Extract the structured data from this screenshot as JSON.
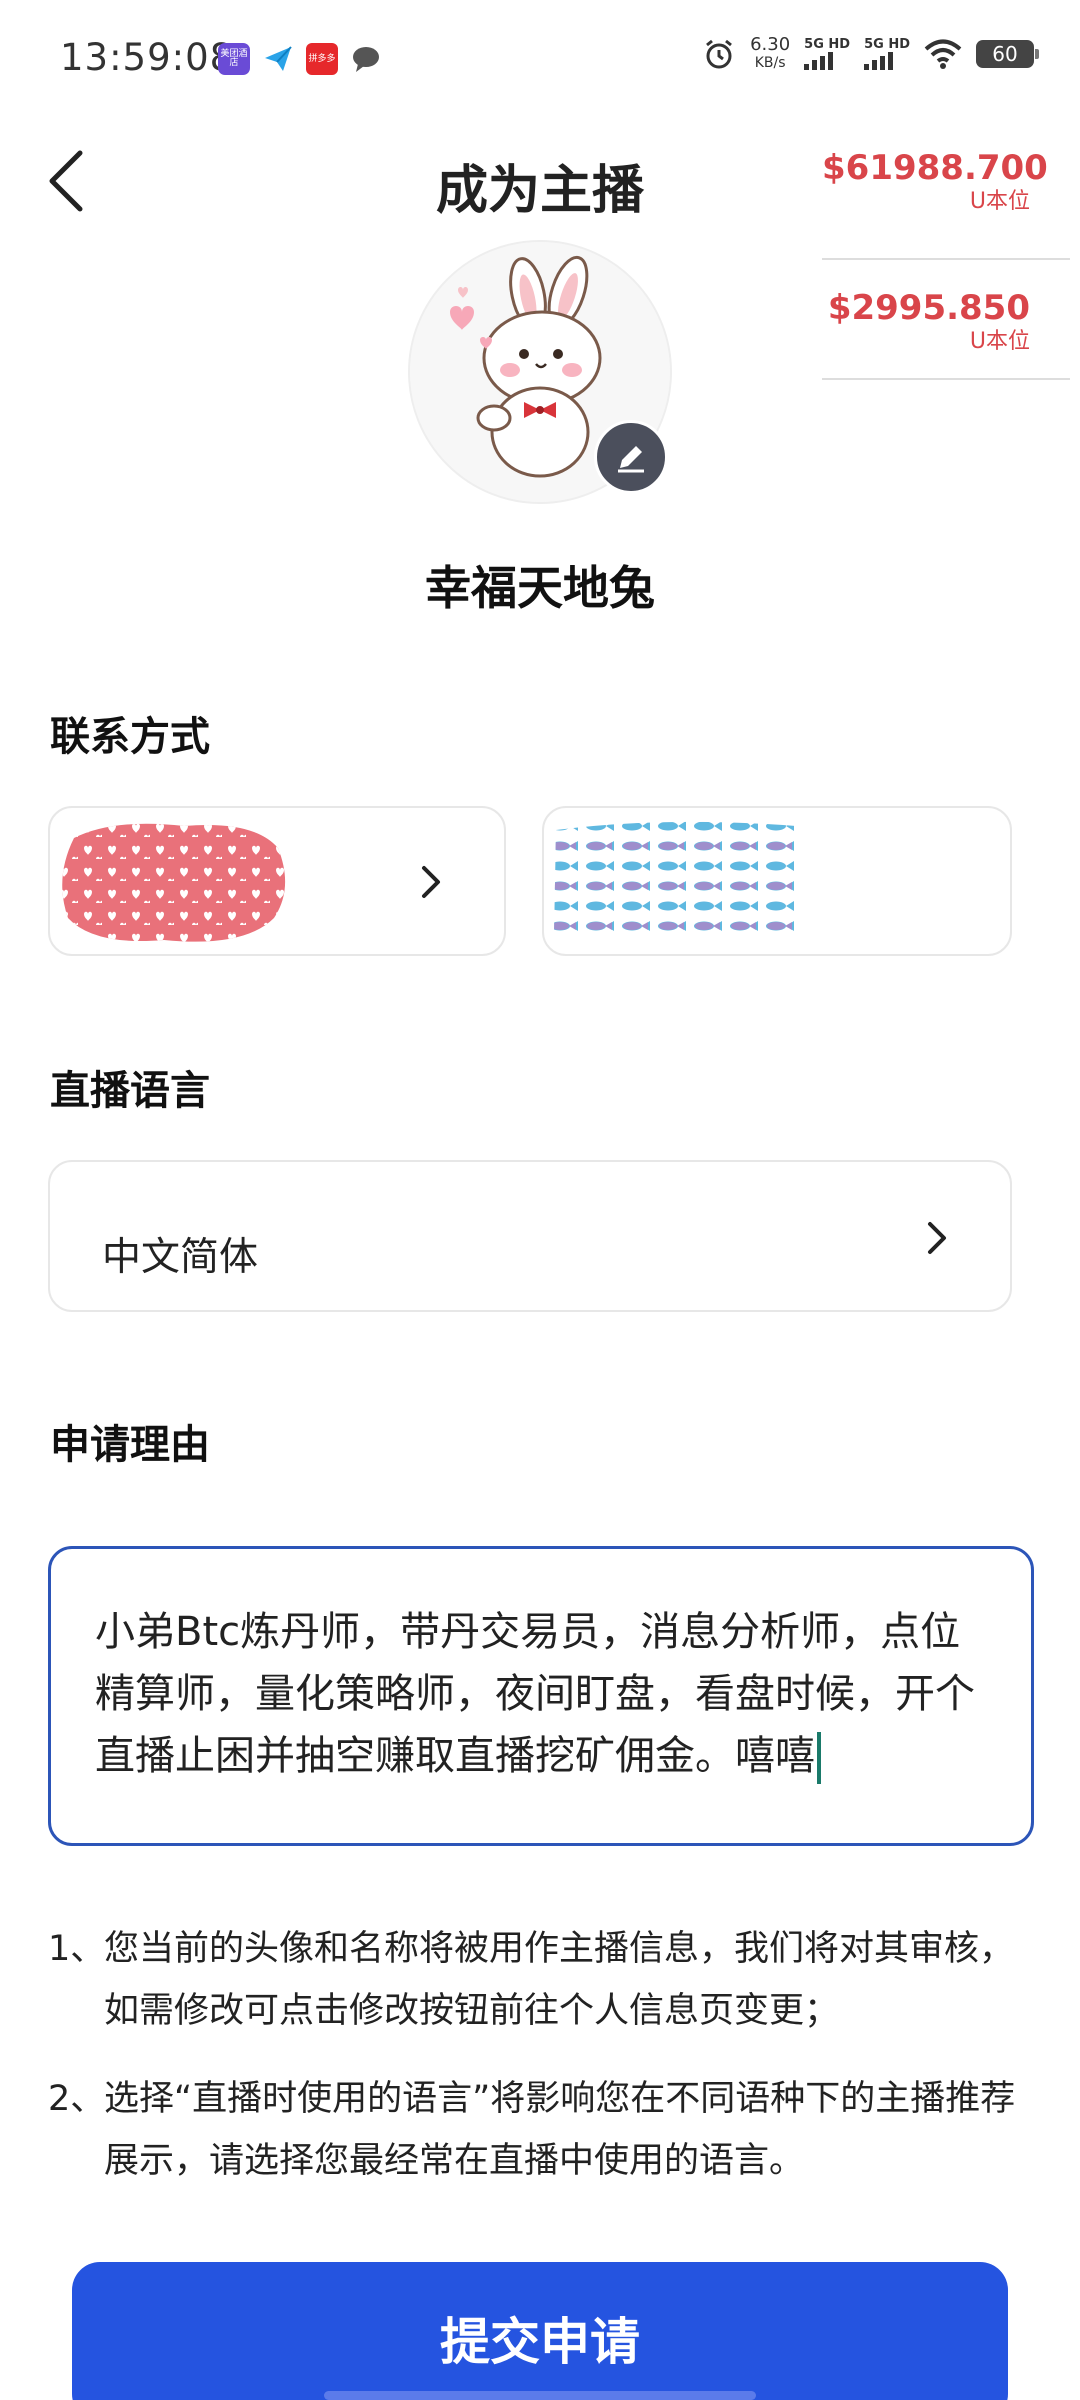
{
  "status_bar": {
    "time": "13:59:08",
    "net_speed_value": "6.30",
    "net_speed_unit": "KB/s",
    "sim1_label": "5G HD",
    "sim2_label": "5G HD",
    "battery": "60",
    "notification_icons": [
      "hotel-app-icon",
      "send-icon",
      "shop-app-icon",
      "chat-bubble-icon"
    ],
    "hotel_icon_text": "美团酒店",
    "shop_icon_text": "拼多多"
  },
  "header": {
    "title": "成为主播",
    "back_icon": "chevron-left-icon"
  },
  "price_widget": {
    "items": [
      {
        "value": "$61988.700",
        "unit": "U本位"
      },
      {
        "value": "$2995.850",
        "unit": "U本位"
      }
    ],
    "color": "#d9454a"
  },
  "profile": {
    "username": "幸福天地兔",
    "edit_icon": "pencil-icon"
  },
  "contact": {
    "label": "联系方式"
  },
  "language": {
    "label": "直播语言",
    "value": "中文简体"
  },
  "reason": {
    "label": "申请理由",
    "text": "小弟Btc炼丹师，带丹交易员，消息分析师，点位精算师，量化策略师，夜间盯盘，看盘时候，开个直播止困并抽空赚取直播挖矿佣金。嘻嘻"
  },
  "notes": [
    {
      "num": "1、",
      "text": "您当前的头像和名称将被用作主播信息，我们将对其审核，如需修改可点击修改按钮前往个人信息页变更；"
    },
    {
      "num": "2、",
      "text": "选择“直播时使用的语言”将影响您在不同语种下的主播推荐展示，请选择您最经常在直播中使用的语言。"
    }
  ],
  "submit": {
    "label": "提交申请"
  },
  "colors": {
    "accent": "#2554e0",
    "input_border": "#2c55b8",
    "price": "#d9454a"
  }
}
